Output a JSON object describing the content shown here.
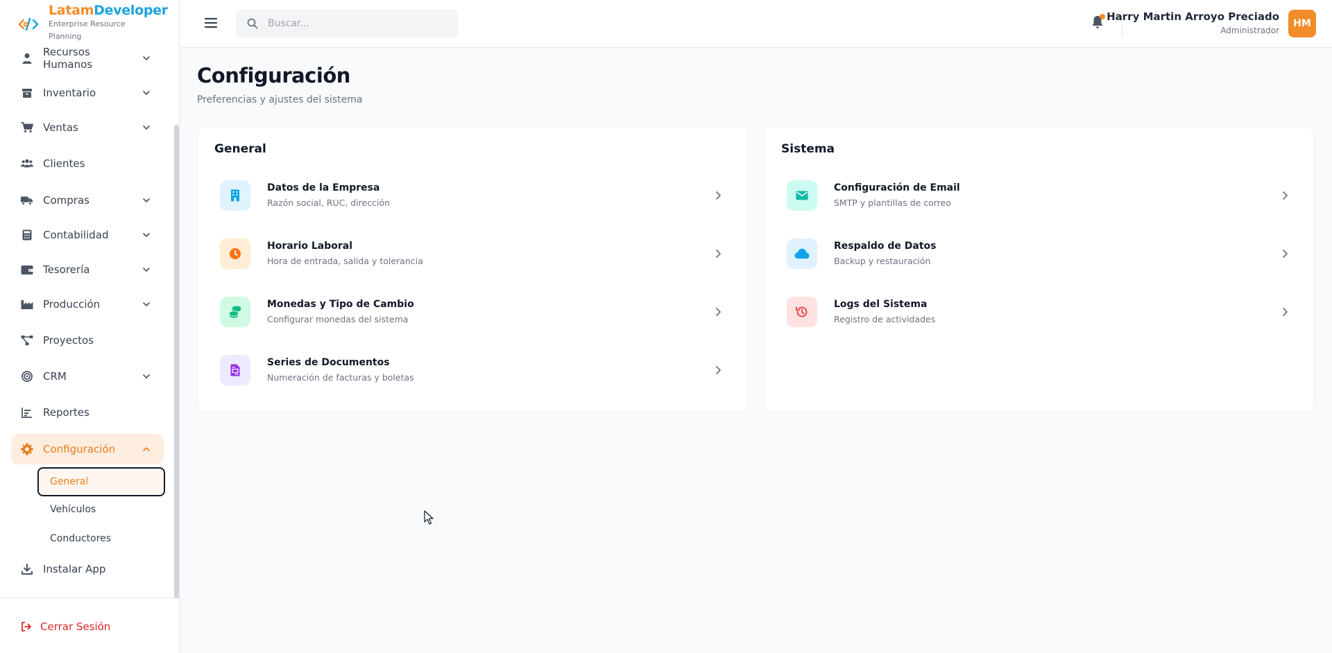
{
  "brand": {
    "name_part1": "Latam",
    "name_part2": "Developer",
    "subtitle": "Enterprise Resource Planning",
    "colors": {
      "orange": "#f28c28",
      "blue": "#1ba3dc"
    }
  },
  "sidebar": {
    "items": [
      {
        "label": "Recursos Humanos",
        "icon": "user-tie-icon",
        "has_chevron": true
      },
      {
        "label": "Inventario",
        "icon": "box-icon",
        "has_chevron": true
      },
      {
        "label": "Ventas",
        "icon": "cart-icon",
        "has_chevron": true
      },
      {
        "label": "Clientes",
        "icon": "users-icon",
        "has_chevron": false
      },
      {
        "label": "Compras",
        "icon": "truck-icon",
        "has_chevron": true
      },
      {
        "label": "Contabilidad",
        "icon": "calculator-icon",
        "has_chevron": true
      },
      {
        "label": "Tesorería",
        "icon": "wallet-icon",
        "has_chevron": true
      },
      {
        "label": "Producción",
        "icon": "factory-icon",
        "has_chevron": true
      },
      {
        "label": "Proyectos",
        "icon": "project-diagram-icon",
        "has_chevron": false
      },
      {
        "label": "CRM",
        "icon": "bullseye-icon",
        "has_chevron": true
      },
      {
        "label": "Reportes",
        "icon": "chart-bar-icon",
        "has_chevron": false
      },
      {
        "label": "Configuración",
        "icon": "gear-icon",
        "has_chevron": true,
        "active": true
      },
      {
        "label": "Instalar App",
        "icon": "download-icon",
        "has_chevron": false
      }
    ],
    "config_subitems": [
      {
        "label": "General",
        "active": true
      },
      {
        "label": "Vehículos"
      },
      {
        "label": "Conductores"
      }
    ],
    "logout_label": "Cerrar Sesión"
  },
  "header": {
    "search_placeholder": "Buscar...",
    "user_name": "Harry Martin Arroyo Preciado",
    "user_role": "Administrador",
    "avatar_initials": "HM"
  },
  "page": {
    "title": "Configuración",
    "subtitle": "Preferencias y ajustes del sistema"
  },
  "sections": {
    "general": {
      "title": "General",
      "items": [
        {
          "title": "Datos de la Empresa",
          "desc": "Razón social, RUC, dirección",
          "icon": "building-icon",
          "color": "#0ea5e9",
          "bg": "#e0f2fe"
        },
        {
          "title": "Horario Laboral",
          "desc": "Hora de entrada, salida y tolerancia",
          "icon": "clock-icon",
          "color": "#f97316",
          "bg": "#ffedd5"
        },
        {
          "title": "Monedas y Tipo de Cambio",
          "desc": "Configurar monedas del sistema",
          "icon": "coins-icon",
          "color": "#10b981",
          "bg": "#d1fae5"
        },
        {
          "title": "Series de Documentos",
          "desc": "Numeración de facturas y boletas",
          "icon": "file-invoice-icon",
          "color": "#9333ea",
          "bg": "#ede9fe"
        }
      ]
    },
    "sistema": {
      "title": "Sistema",
      "items": [
        {
          "title": "Configuración de Email",
          "desc": "SMTP y plantillas de correo",
          "icon": "envelope-icon",
          "color": "#14b8a6",
          "bg": "#ccfbf1"
        },
        {
          "title": "Respaldo de Datos",
          "desc": "Backup y restauración",
          "icon": "cloud-icon",
          "color": "#0ea5e9",
          "bg": "#e0f2fe"
        },
        {
          "title": "Logs del Sistema",
          "desc": "Registro de actividades",
          "icon": "history-icon",
          "color": "#ef4444",
          "bg": "#fee2e2"
        }
      ]
    }
  }
}
